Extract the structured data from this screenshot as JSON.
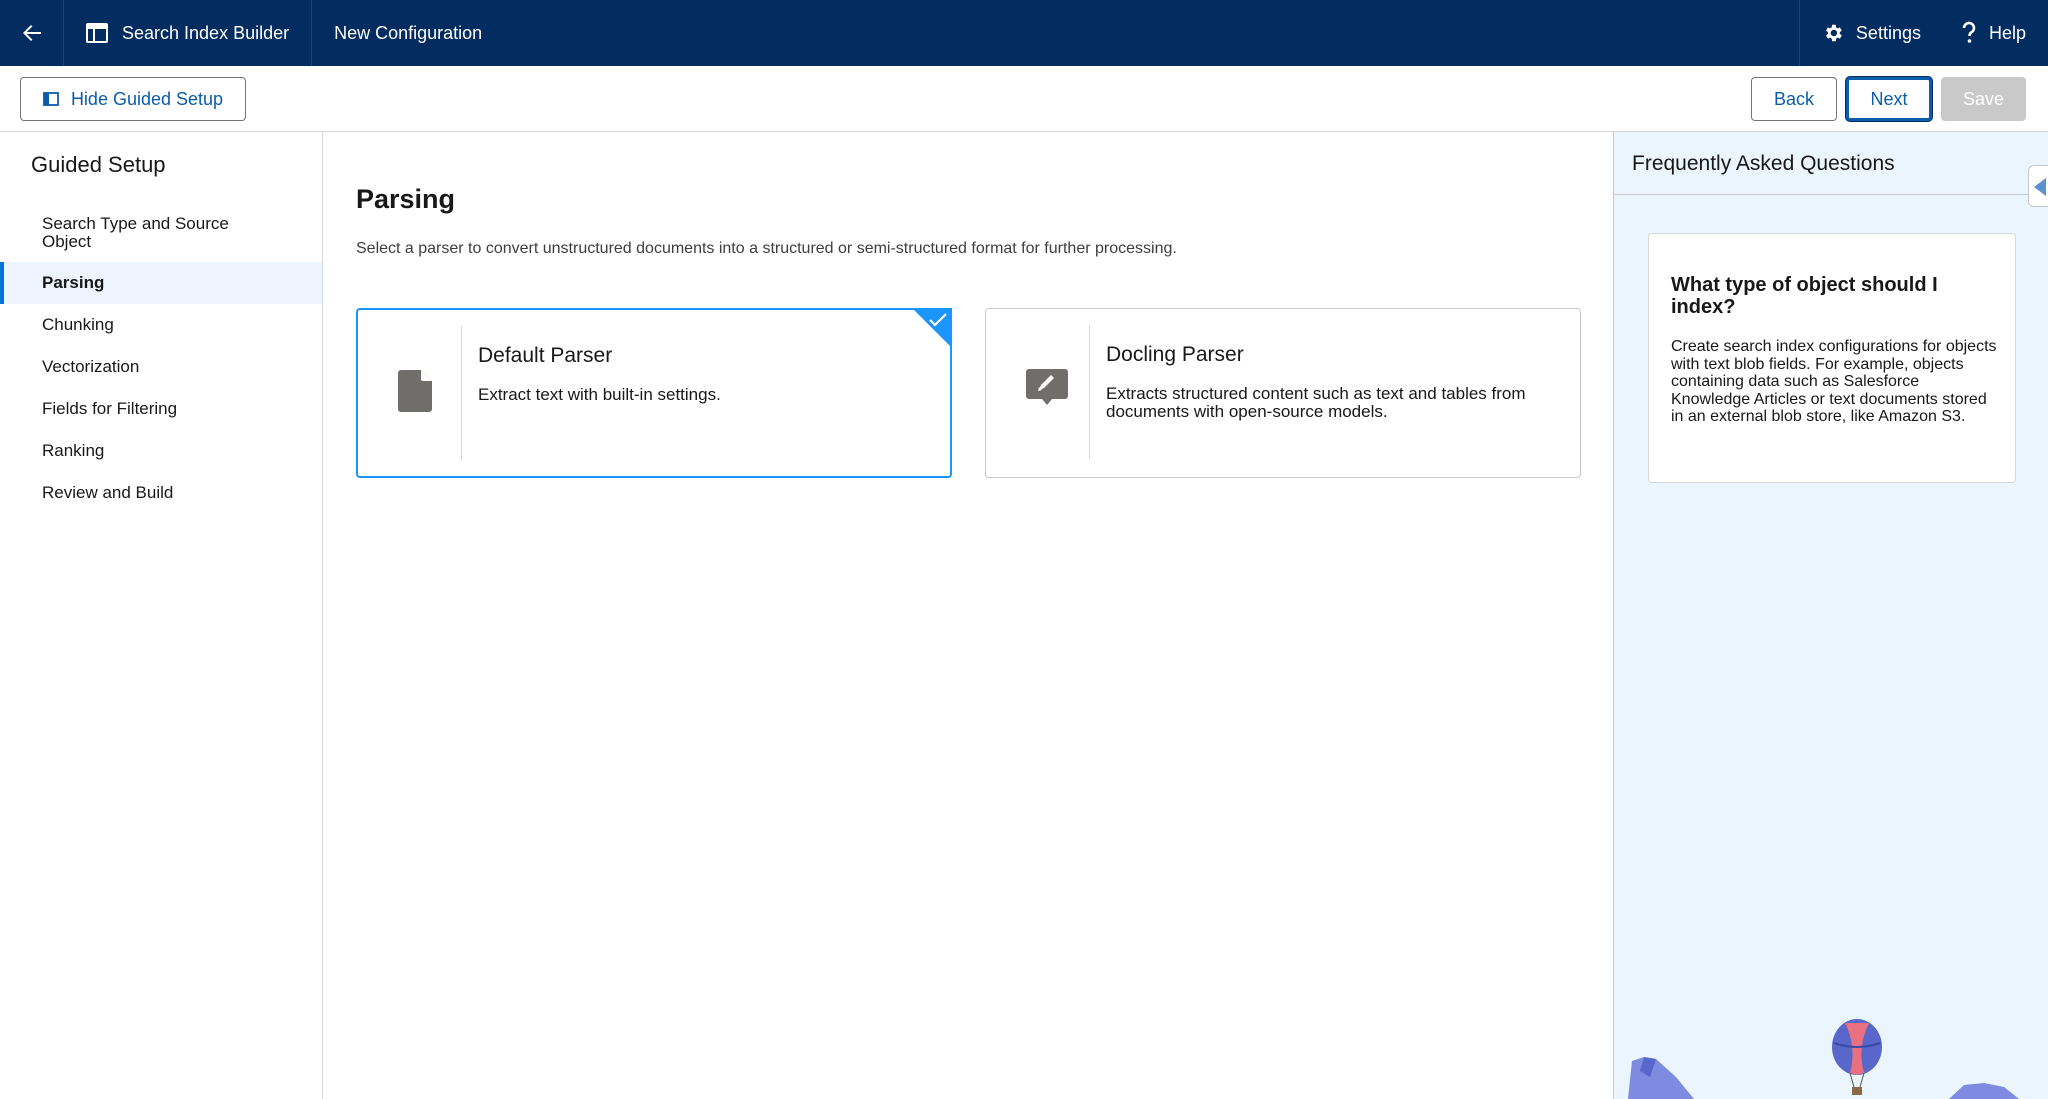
{
  "topbar": {
    "app_name": "Search Index Builder",
    "tab_label": "New Configuration",
    "settings_label": "Settings",
    "help_label": "Help"
  },
  "toolbar": {
    "hide_guided_setup_label": "Hide Guided Setup",
    "back_label": "Back",
    "next_label": "Next",
    "save_label": "Save"
  },
  "sidebar": {
    "title": "Guided Setup",
    "steps": [
      {
        "label": "Search Type and Source Object"
      },
      {
        "label": "Parsing"
      },
      {
        "label": "Chunking"
      },
      {
        "label": "Vectorization"
      },
      {
        "label": "Fields for Filtering"
      },
      {
        "label": "Ranking"
      },
      {
        "label": "Review and Build"
      }
    ],
    "active_step": "Parsing"
  },
  "main": {
    "title": "Parsing",
    "description": "Select a parser to convert unstructured documents into a structured or semi-structured format for further processing.",
    "parsers": [
      {
        "title": "Default Parser",
        "description": "Extract text with built-in settings.",
        "icon": "document-icon",
        "selected": true
      },
      {
        "title": "Docling Parser",
        "description": "Extracts structured content such as text and tables from documents with open-source models.",
        "icon": "edit-comment-icon",
        "selected": false
      }
    ]
  },
  "faq": {
    "title": "Frequently Asked Questions",
    "question": "What type of object should I index?",
    "answer": "Create search index configurations for objects with text blob fields. For example, objects containing data such as Salesforce Knowledge Articles or text documents stored in an external blob store, like Amazon S3."
  },
  "colors": {
    "nav_bg": "#032d60",
    "brand_blue": "#0176d3",
    "selected_border": "#1b96ff",
    "faq_bg": "#eaf5fe"
  }
}
